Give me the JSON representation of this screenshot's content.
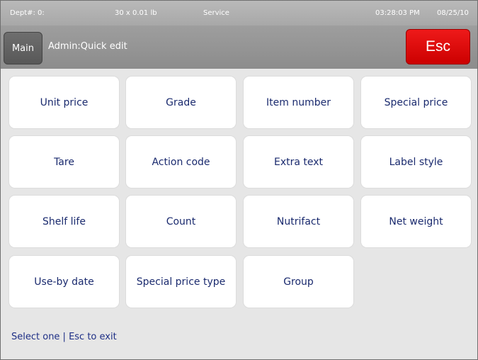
{
  "status": {
    "dept": "Dept#: 0:",
    "capacity": "30 x 0.01 lb",
    "mode": "Service",
    "time": "03:28:03 PM",
    "date": "08/25/10"
  },
  "header": {
    "main_label": "Main",
    "title": "Admin:Quick edit",
    "esc_label": "Esc"
  },
  "options": [
    "Unit price",
    "Grade",
    "Item number",
    "Special price",
    "Tare",
    "Action code",
    "Extra text",
    "Label style",
    "Shelf life",
    "Count",
    "Nutrifact",
    "Net weight",
    "Use-by date",
    "Special price type",
    "Group"
  ],
  "footer": {
    "hint": "Select one | Esc to exit"
  },
  "colors": {
    "esc_button": "#e00000",
    "tile_text": "#1a2a6e",
    "header_gray": "#999999"
  }
}
